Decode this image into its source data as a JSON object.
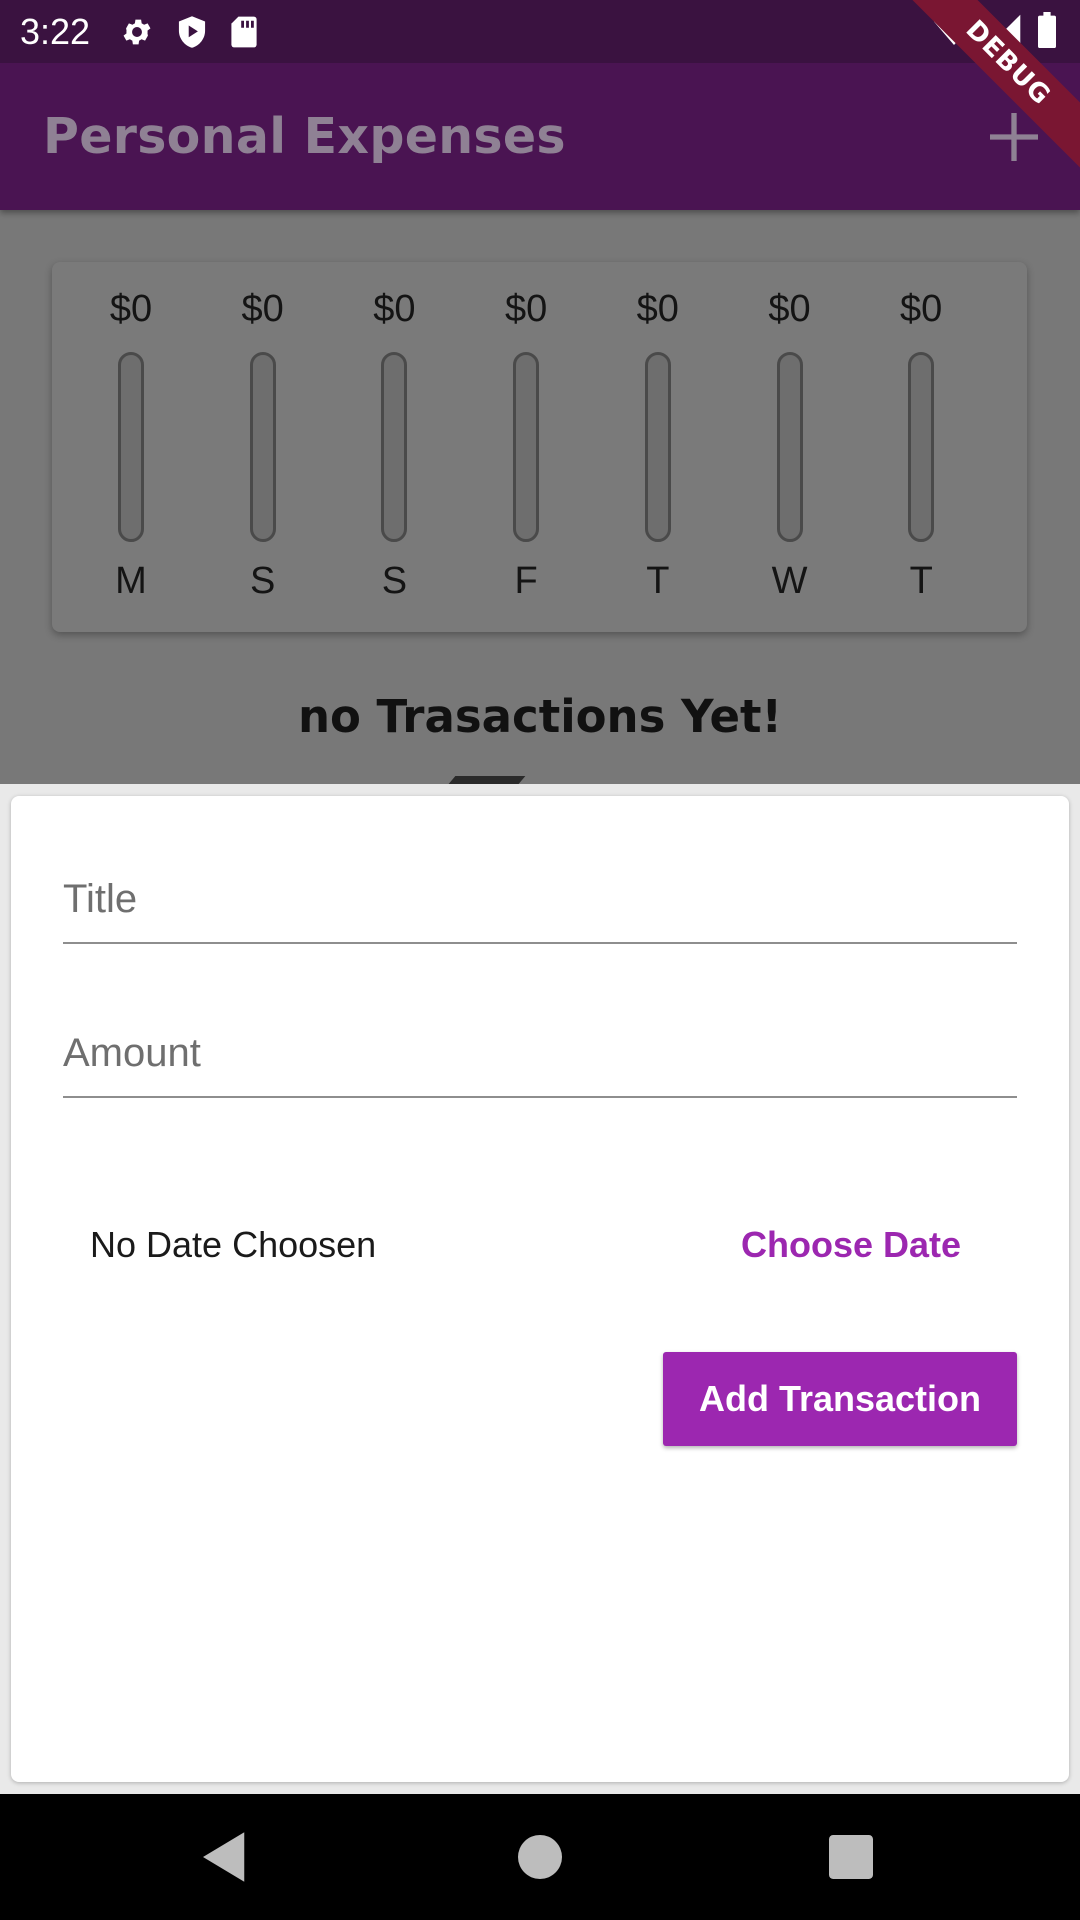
{
  "status_bar": {
    "time": "3:22",
    "icons_left": [
      "settings-icon",
      "shield-play-icon",
      "sd-card-icon"
    ],
    "icons_right": [
      "wifi-icon",
      "signal-icon",
      "battery-icon"
    ]
  },
  "debug_banner": "DEBUG",
  "app_bar": {
    "title": "Personal Expenses",
    "action_icon": "add-icon"
  },
  "chart_data": {
    "type": "bar",
    "categories": [
      "M",
      "S",
      "S",
      "F",
      "T",
      "W",
      "T"
    ],
    "values": [
      0,
      0,
      0,
      0,
      0,
      0,
      0
    ],
    "labels": [
      "$0",
      "$0",
      "$0",
      "$0",
      "$0",
      "$0",
      "$0"
    ],
    "title": "",
    "xlabel": "",
    "ylabel": ""
  },
  "empty_state": "no Trasactions Yet!",
  "form": {
    "title_placeholder": "Title",
    "title_value": "",
    "amount_placeholder": "Amount",
    "amount_value": "",
    "date_text": "No Date Choosen",
    "choose_date_label": "Choose Date",
    "submit_label": "Add Transaction"
  },
  "colors": {
    "accent": "#9c27b0",
    "app_bar": "#4a1452",
    "status_bar": "#3a1240"
  },
  "nav_bar": [
    "back-icon",
    "home-icon",
    "recents-icon"
  ]
}
